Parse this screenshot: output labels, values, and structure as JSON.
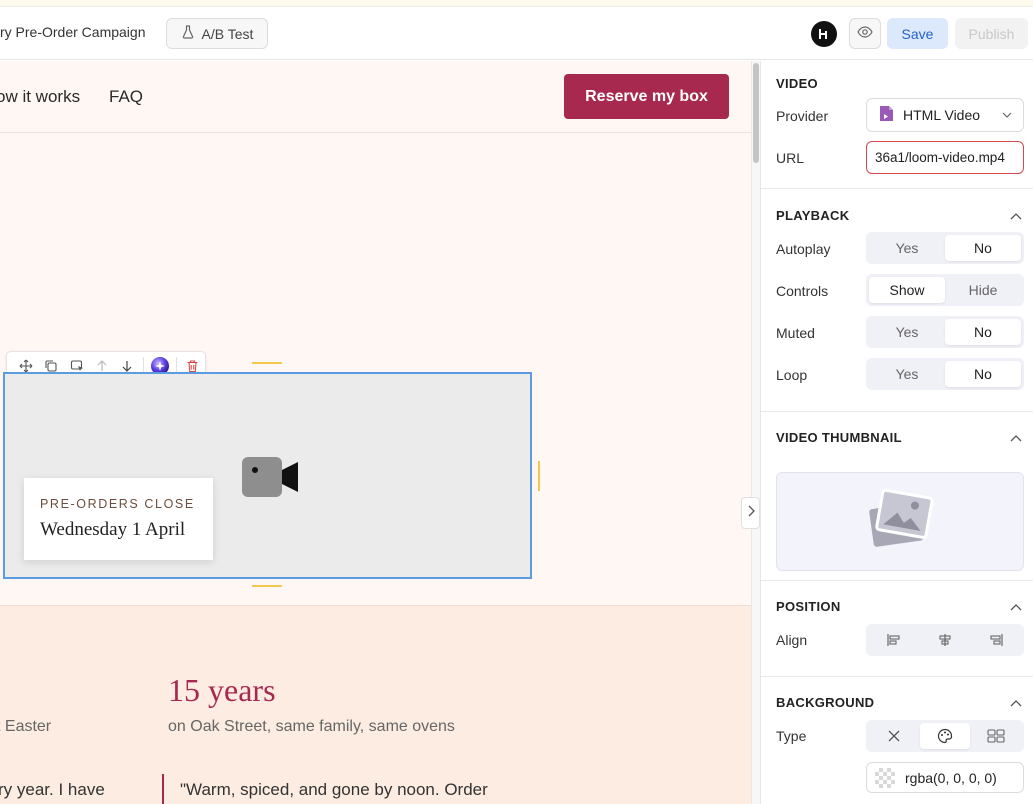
{
  "header": {
    "campaign_name": "ry Pre-Order Campaign",
    "ab_test_label": "A/B Test",
    "save_label": "Save",
    "publish_label": "Publish"
  },
  "site": {
    "nav": [
      "ow it works",
      "FAQ"
    ],
    "cta_label": "Reserve my box",
    "overlay": {
      "label": "PRE-ORDERS CLOSE",
      "date": "Wednesday 1 April"
    },
    "add_label": "+",
    "stat_title": "15 years",
    "stat_sub": "on Oak Street, same family, same ovens",
    "left_sub": "t Easter",
    "left_quote": "ry year. I have",
    "quote": "\"Warm, spiced, and gone by noon. Order"
  },
  "panel": {
    "video": {
      "title": "VIDEO",
      "provider_label": "Provider",
      "provider_value": "HTML Video",
      "url_label": "URL",
      "url_value": "36a1/loom-video.mp4"
    },
    "playback": {
      "title": "PLAYBACK",
      "rows": [
        {
          "label": "Autoplay",
          "options": [
            "Yes",
            "No"
          ],
          "selected": "No"
        },
        {
          "label": "Controls",
          "options": [
            "Show",
            "Hide"
          ],
          "selected": "Show"
        },
        {
          "label": "Muted",
          "options": [
            "Yes",
            "No"
          ],
          "selected": "No"
        },
        {
          "label": "Loop",
          "options": [
            "Yes",
            "No"
          ],
          "selected": "No"
        }
      ]
    },
    "thumbnail": {
      "title": "VIDEO THUMBNAIL"
    },
    "position": {
      "title": "POSITION",
      "align_label": "Align",
      "align_options": [
        "left-align-icon",
        "center-align-icon",
        "right-align-icon"
      ]
    },
    "background": {
      "title": "BACKGROUND",
      "type_label": "Type",
      "type_options": [
        "none-icon",
        "palette-icon",
        "image-icon"
      ],
      "selected_type": "palette-icon",
      "color_value": "rgba(0, 0, 0, 0)"
    }
  },
  "colors": {
    "brand": "#a8294f",
    "accent": "#2562c9",
    "selection": "#5b9ce0",
    "error": "#d9494b"
  }
}
